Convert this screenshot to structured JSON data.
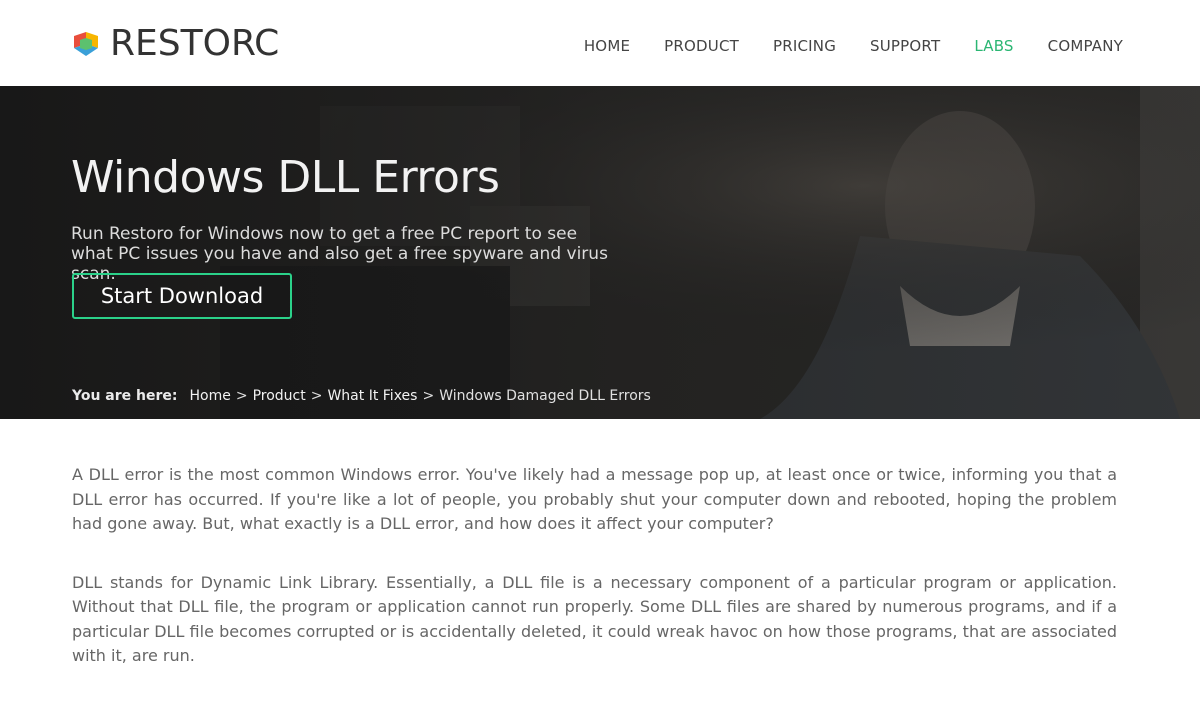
{
  "header": {
    "logo_text": "RESTORC",
    "logo_icon": "restoro-cube-icon",
    "nav": [
      {
        "label": "HOME",
        "active": false
      },
      {
        "label": "PRODUCT",
        "active": false
      },
      {
        "label": "PRICING",
        "active": false
      },
      {
        "label": "SUPPORT",
        "active": false
      },
      {
        "label": "LABS",
        "active": true
      },
      {
        "label": "COMPANY",
        "active": false
      }
    ]
  },
  "hero": {
    "title": "Windows DLL Errors",
    "subtitle": "Run Restoro for Windows now to get a free PC report to see what PC issues you have and also get a free spyware and virus scan.",
    "cta_label": "Start Download",
    "breadcrumb": {
      "label": "You are here:",
      "items": [
        "Home",
        "Product",
        "What It Fixes"
      ],
      "separator": ">",
      "current": "Windows Damaged DLL Errors"
    }
  },
  "content": {
    "paragraphs": [
      "A DLL error is the most common Windows error. You've likely had a message pop up, at least once or twice, informing you that a DLL error has occurred. If you're like a lot of people, you probably shut your computer down and rebooted, hoping the problem had gone away. But, what exactly is a DLL error, and how does it affect your computer?",
      "DLL stands for Dynamic Link Library. Essentially, a DLL file is a necessary component of a particular program or application. Without that DLL file, the program or application cannot run properly. Some DLL files are shared by numerous programs, and if a particular DLL file becomes corrupted or is accidentally deleted, it could wreak havoc on how those programs, that are associated with it, are run."
    ]
  },
  "colors": {
    "accent": "#2bb673",
    "cta_border": "#2bd18a",
    "hero_bg": "#262626",
    "text": "#666666"
  }
}
